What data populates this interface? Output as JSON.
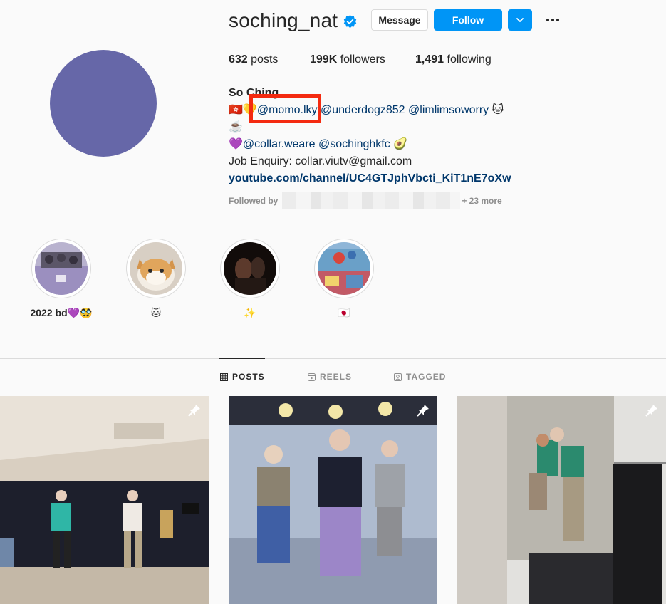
{
  "profile": {
    "username": "soching_nat",
    "message_label": "Message",
    "follow_label": "Follow",
    "posts_count": "632",
    "posts_label": "posts",
    "followers_count": "199K",
    "followers_label": "followers",
    "following_count": "1,491",
    "following_label": "following"
  },
  "bio": {
    "name": "So Ching",
    "line1_prefix": "🇭🇰💛",
    "mention1": "@momo.lky",
    "mention2": "@underdogz852",
    "mention3": "@limlimsoworry",
    "line1_suffix": "🐱",
    "line2": "☕️",
    "line3_prefix": "💜",
    "mention4": "@collar.weare",
    "mention5": "@sochinghkfc",
    "line3_suffix": "🥑",
    "job": "Job Enquiry: collar.viutv@gmail.com",
    "link": "youtube.com/channel/UC4GTJphVbcti_KiT1nE7oXw"
  },
  "followed_by": {
    "label": "Followed by",
    "more": "+ 23 more"
  },
  "highlights": [
    {
      "label": "2022 bd💜🥸"
    },
    {
      "label": "🐱"
    },
    {
      "label": "✨"
    },
    {
      "label": "🇯🇵"
    }
  ],
  "tabs": [
    {
      "label": "POSTS",
      "icon": "grid-icon",
      "active": true
    },
    {
      "label": "REELS",
      "icon": "reels-icon",
      "active": false
    },
    {
      "label": "TAGGED",
      "icon": "tagged-icon",
      "active": false
    }
  ],
  "colors": {
    "accent": "#0095f6",
    "link": "#00376b",
    "highlight_box": "#f42a10",
    "avatar": "#6667a8"
  }
}
